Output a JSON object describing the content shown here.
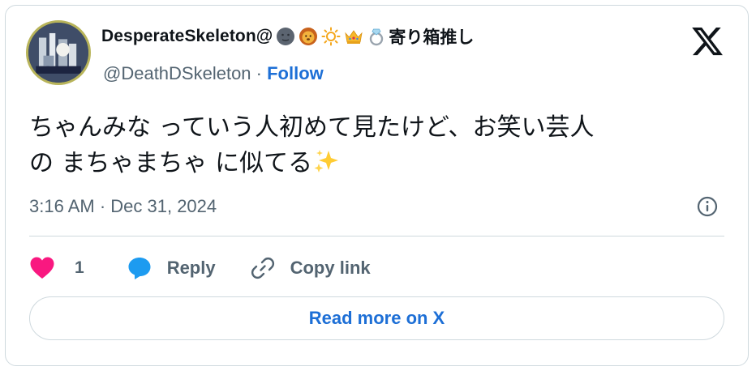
{
  "author": {
    "display_name": "DesperateSkeleton@",
    "name_emojis": [
      "dark-moon-face-emoji",
      "lion-face-emoji",
      "sun-emoji",
      "crown-emoji",
      "ring-emoji"
    ],
    "name_suffix": "寄り箱推し",
    "handle": "@DeathDSkeleton",
    "separator": " · ",
    "follow_label": "Follow"
  },
  "tweet": {
    "line1": "ちゃんみな っていう人初めて見たけど、お笑い芸人",
    "line2": "の まちゃまちゃ に似てる",
    "trailing_emoji": "sparkles-emoji"
  },
  "meta": {
    "timestamp": "3:16 AM · Dec 31, 2024"
  },
  "actions": {
    "like_count": "1",
    "reply_label": "Reply",
    "copy_link_label": "Copy link"
  },
  "footer": {
    "read_more_label": "Read more on X"
  },
  "colors": {
    "accent": "#1d6fd6",
    "like": "#f91880",
    "reply_bubble": "#1d9bf0",
    "muted": "#536471",
    "border": "#cfd9de"
  }
}
